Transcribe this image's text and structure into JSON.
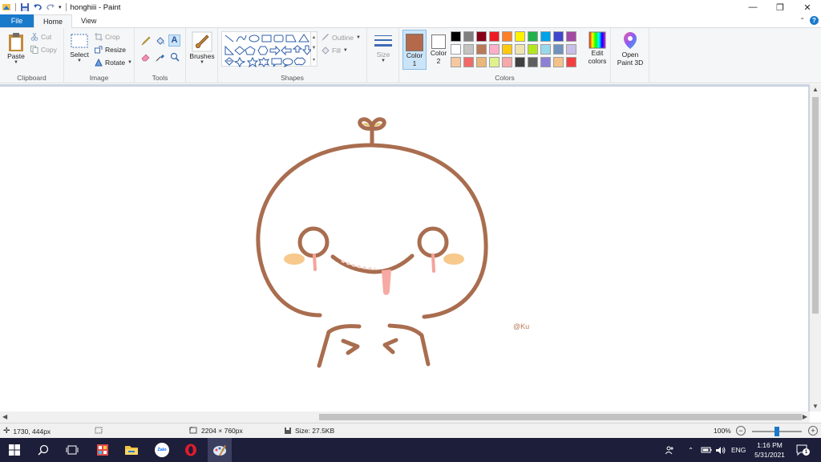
{
  "window": {
    "title": "honghiii - Paint",
    "controls": {
      "minimize": "—",
      "restore": "❐",
      "close": "✕"
    }
  },
  "tabs": [
    {
      "label": "File"
    },
    {
      "label": "Home"
    },
    {
      "label": "View"
    }
  ],
  "ribbon": {
    "clipboard": {
      "label": "Clipboard",
      "paste": "Paste",
      "cut": "Cut",
      "copy": "Copy"
    },
    "image": {
      "label": "Image",
      "select": "Select",
      "crop": "Crop",
      "resize": "Resize",
      "rotate": "Rotate"
    },
    "tools": {
      "label": "Tools"
    },
    "brushes": {
      "label": "Brushes"
    },
    "shapes": {
      "label": "Shapes",
      "outline": "Outline",
      "fill": "Fill"
    },
    "size": {
      "label": "Size"
    },
    "colors": {
      "label": "Colors",
      "color1_label": "Color",
      "color1_num": "1",
      "color2_label": "Color",
      "color2_num": "2",
      "color1_value": "#b4694a",
      "color2_value": "#ffffff",
      "edit_label": "Edit",
      "edit_label2": "colors",
      "palette": [
        "#000000",
        "#7f7f7f",
        "#880015",
        "#ed1c24",
        "#ff7f27",
        "#fff200",
        "#22b14c",
        "#00a2e8",
        "#3f48cc",
        "#a349a4",
        "#ffffff",
        "#c3c3c3",
        "#b97a57",
        "#ffaec9",
        "#ffc90e",
        "#efe4b0",
        "#b5e61d",
        "#99d9ea",
        "#7092be",
        "#c8bfe7",
        "#f5c8a0",
        "#f06a6a",
        "#e9b77a",
        "#dff28d",
        "#f7a8a8",
        "#404040",
        "#606060",
        "#8e7fd6",
        "#f4c289",
        "#f24040"
      ]
    },
    "paint3d": {
      "label1": "Open",
      "label2": "Paint 3D"
    }
  },
  "canvas": {
    "signature": "@Ku",
    "stroke_color": "#a96d4f",
    "cheek_color": "#f7c98c",
    "tear_color": "#f4a49a"
  },
  "status": {
    "cursor_pos": "1730, 444px",
    "selection_size": "",
    "image_size": "2204 × 760px",
    "file_size": "Size: 27.5KB",
    "zoom": "100%"
  },
  "taskbar": {
    "lang": "ENG",
    "time": "1:16 PM",
    "date": "5/31/2021",
    "zalo_label": "Zalo",
    "notification_count": "1"
  }
}
